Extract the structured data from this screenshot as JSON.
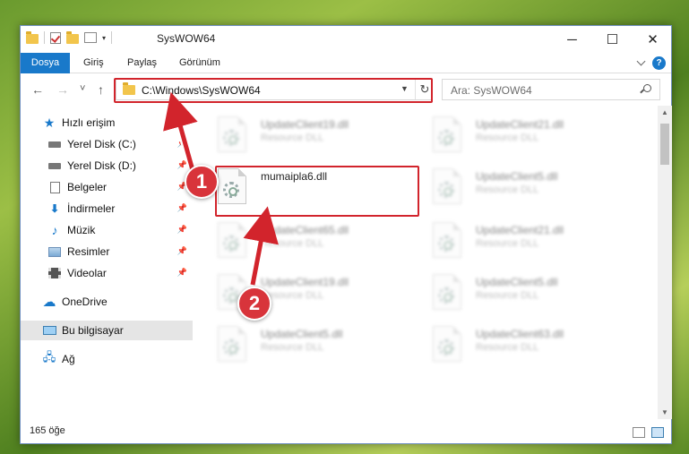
{
  "window": {
    "title": "SysWOW64",
    "controls": {
      "minimize": "─",
      "maximize": "☐",
      "close": "✕"
    }
  },
  "ribbon": {
    "tabs": [
      "Dosya",
      "Giriş",
      "Paylaş",
      "Görünüm"
    ],
    "help": "?"
  },
  "nav": {
    "back": "←",
    "forward": "→",
    "recent": "˅",
    "up": "↑",
    "address": "C:\\Windows\\SysWOW64",
    "refresh": "↻",
    "search_placeholder": "Ara: SysWOW64"
  },
  "sidebar": {
    "quick_access": "Hızlı erişim",
    "items": [
      {
        "label": "Yerel Disk (C:)",
        "icon": "drive-icon"
      },
      {
        "label": "Yerel Disk (D:)",
        "icon": "drive-icon"
      },
      {
        "label": "Belgeler",
        "icon": "documents-icon"
      },
      {
        "label": "İndirmeler",
        "icon": "downloads-icon"
      },
      {
        "label": "Müzik",
        "icon": "music-icon"
      },
      {
        "label": "Resimler",
        "icon": "pictures-icon"
      },
      {
        "label": "Videolar",
        "icon": "videos-icon"
      }
    ],
    "onedrive": "OneDrive",
    "this_pc": "Bu bilgisayar",
    "network": "Ağ"
  },
  "files": {
    "left": [
      {
        "name": "UpdateClient19.dll",
        "type": "Resource DLL"
      },
      {
        "name": "mumaipla6.dll",
        "type": ""
      },
      {
        "name": "UpdateClient65.dll",
        "type": "Resource DLL"
      },
      {
        "name": "UpdateClient19.dll",
        "type": "Resource DLL"
      },
      {
        "name": "UpdateClient5.dll",
        "type": "Resource DLL"
      }
    ],
    "right": [
      {
        "name": "UpdateClient21.dll",
        "type": "Resource DLL"
      },
      {
        "name": "UpdateClient5.dll",
        "type": "Resource DLL"
      },
      {
        "name": "UpdateClient21.dll",
        "type": "Resource DLL"
      },
      {
        "name": "UpdateClient5.dll",
        "type": "Resource DLL"
      },
      {
        "name": "UpdateClient63.dll",
        "type": "Resource DLL"
      }
    ]
  },
  "status": {
    "count": "165 öğe"
  },
  "annotations": {
    "badge1": "1",
    "badge2": "2",
    "color": "#d2242c"
  }
}
